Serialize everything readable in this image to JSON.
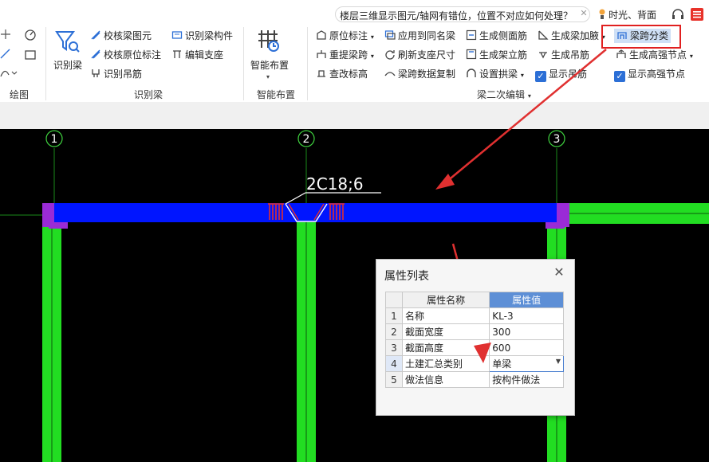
{
  "topbar": {
    "search_text": "楼层三维显示图元/轴网有错位，位置不对应如何处理？",
    "user_text": "时光、背面"
  },
  "ribbon": {
    "draw_group": {
      "label": "绘图"
    },
    "identify_group": {
      "label": "识别梁",
      "big_button": "识别梁",
      "items": [
        "校核梁图元",
        "校核原位标注",
        "识别吊筋",
        "识别梁构件",
        "编辑支座"
      ]
    },
    "smart_group": {
      "label": "智能布置",
      "big_button": "智能布置"
    },
    "edit_group": {
      "label": "梁二次编辑",
      "col1": [
        "原位标注",
        "重提梁跨",
        "查改标高"
      ],
      "col2": [
        "应用到同名梁",
        "刷新支座尺寸",
        "梁跨数据复制"
      ],
      "col3": [
        "生成侧面筋",
        "生成架立筋",
        "设置拱梁"
      ],
      "col4": [
        "生成梁加腋",
        "生成吊筋",
        "显示吊筋"
      ],
      "col5": [
        "梁跨分类",
        "生成高强节点",
        "显示高强节点"
      ]
    }
  },
  "canvas": {
    "axes": [
      "1",
      "2",
      "3"
    ],
    "rebar_label": "2C18;6"
  },
  "dialog": {
    "title": "属性列表",
    "headers": [
      "属性名称",
      "属性值"
    ],
    "rows": [
      {
        "idx": "1",
        "name": "名称",
        "value": "KL-3"
      },
      {
        "idx": "2",
        "name": "截面宽度",
        "value": "300"
      },
      {
        "idx": "3",
        "name": "截面高度",
        "value": "600"
      },
      {
        "idx": "4",
        "name": "土建汇总类别",
        "value": "单梁"
      },
      {
        "idx": "5",
        "name": "做法信息",
        "value": "按构件做法"
      }
    ]
  },
  "colors": {
    "beam": "#0015ff",
    "column": "#22dd22",
    "support": "#9a2bd6",
    "annotation_red": "#e03030",
    "highlight_border": "#e02020"
  }
}
